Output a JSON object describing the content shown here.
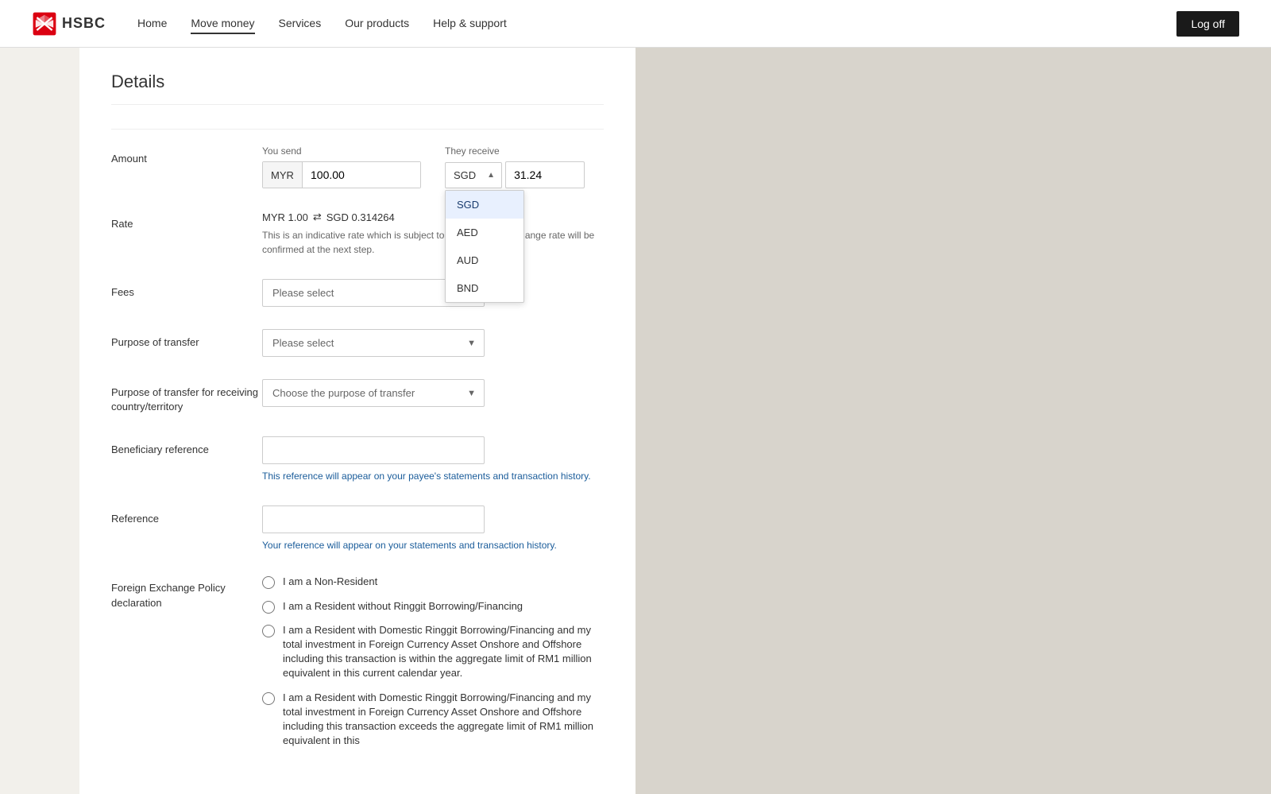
{
  "navbar": {
    "logo_text": "HSBC",
    "links": [
      {
        "label": "Home",
        "active": false
      },
      {
        "label": "Move money",
        "active": true
      },
      {
        "label": "Services",
        "active": false
      },
      {
        "label": "Our products",
        "active": false
      },
      {
        "label": "Help & support",
        "active": false
      }
    ],
    "logout_label": "Log off"
  },
  "page": {
    "title": "Details"
  },
  "form": {
    "amount_label": "Amount",
    "you_send_label": "You send",
    "they_receive_label": "They receive",
    "send_currency": "MYR",
    "send_amount": "100.00",
    "receive_currency": "SGD",
    "receive_amount": "31.24",
    "rate_label": "Rate",
    "rate_from": "MYR 1.00",
    "rate_arrow": "⇄",
    "rate_value": "SGD 0.31",
    "rate_suffix": "4264",
    "rate_note": "This is an indicative rate which is subject to change, your exchange rate will be confirmed at the next step.",
    "fees_label": "Fees",
    "fees_placeholder": "Please select",
    "purpose_label": "Purpose of transfer",
    "purpose_placeholder": "Please select",
    "purpose_country_label": "Purpose of transfer for receiving country/territory",
    "purpose_country_placeholder": "Choose the purpose of transfer",
    "beneficiary_ref_label": "Beneficiary reference",
    "beneficiary_ref_note": "This reference will appear on your payee's statements and transaction history.",
    "reference_label": "Reference",
    "reference_note": "Your reference will appear on your statements and transaction history.",
    "fx_policy_label": "Foreign Exchange Policy declaration",
    "radio_options": [
      {
        "id": "r1",
        "label": "I am a Non-Resident"
      },
      {
        "id": "r2",
        "label": "I am a Resident without Ringgit Borrowing/Financing"
      },
      {
        "id": "r3",
        "label": "I am a Resident with Domestic Ringgit Borrowing/Financing and my total investment in Foreign Currency Asset Onshore and Offshore including this transaction is within the aggregate limit of RM1 million equivalent in this current calendar year."
      },
      {
        "id": "r4",
        "label": "I am a Resident with Domestic Ringgit Borrowing/Financing and my total investment in Foreign Currency Asset Onshore and Offshore including this transaction exceeds the aggregate limit of RM1 million equivalent in this"
      }
    ]
  },
  "currency_dropdown": {
    "options": [
      "SGD",
      "AED",
      "AUD",
      "BND"
    ],
    "selected": "SGD"
  }
}
